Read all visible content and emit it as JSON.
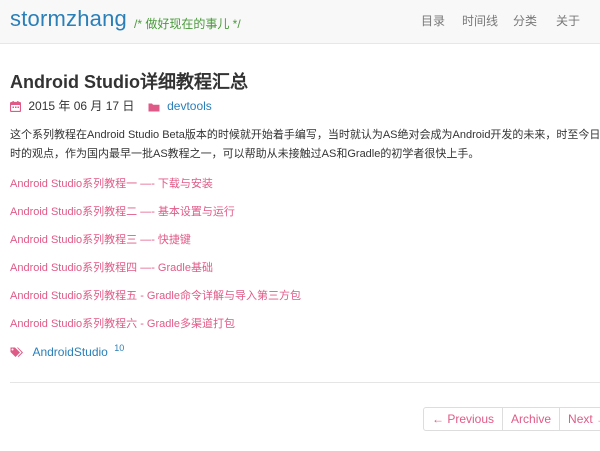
{
  "header": {
    "brand": "stormzhang",
    "tagline": "/* 做好现在的事儿 */",
    "nav": [
      {
        "label": "目录"
      },
      {
        "label": "时间线"
      },
      {
        "label": "分类"
      },
      {
        "label": "关于"
      }
    ]
  },
  "post": {
    "title": "Android Studio详细教程汇总",
    "date": "2015 年 06 月 17 日",
    "category": "devtools",
    "intro_lines": [
      "这个系列教程在Android Studio Beta版本的时候就开始着手编写，当时就认为AS绝对会成为Android开发的未来，时至今日印证了当",
      "时的观点，作为国内最早一批AS教程之一，可以帮助从未接触过AS和Gradle的初学者很快上手。"
    ],
    "links": [
      "Android Studio系列教程一 —- 下载与安装",
      "Android Studio系列教程二 —- 基本设置与运行",
      "Android Studio系列教程三 —- 快捷键",
      "Android Studio系列教程四 —- Gradle基础",
      "Android Studio系列教程五 - Gradle命令详解与导入第三方包",
      "Android Studio系列教程六 - Gradle多渠道打包"
    ],
    "tag": {
      "label": "AndroidStudio",
      "count": "10"
    }
  },
  "pager": {
    "previous": "← Previous",
    "archive": "Archive",
    "next": "Next →"
  },
  "colors": {
    "brand": "#2a7fb8",
    "tagline": "#4a9a3b",
    "link": "#e05a88"
  },
  "icons": {
    "date": "calendar-icon",
    "category": "folder-icon",
    "tag": "tags-icon"
  }
}
